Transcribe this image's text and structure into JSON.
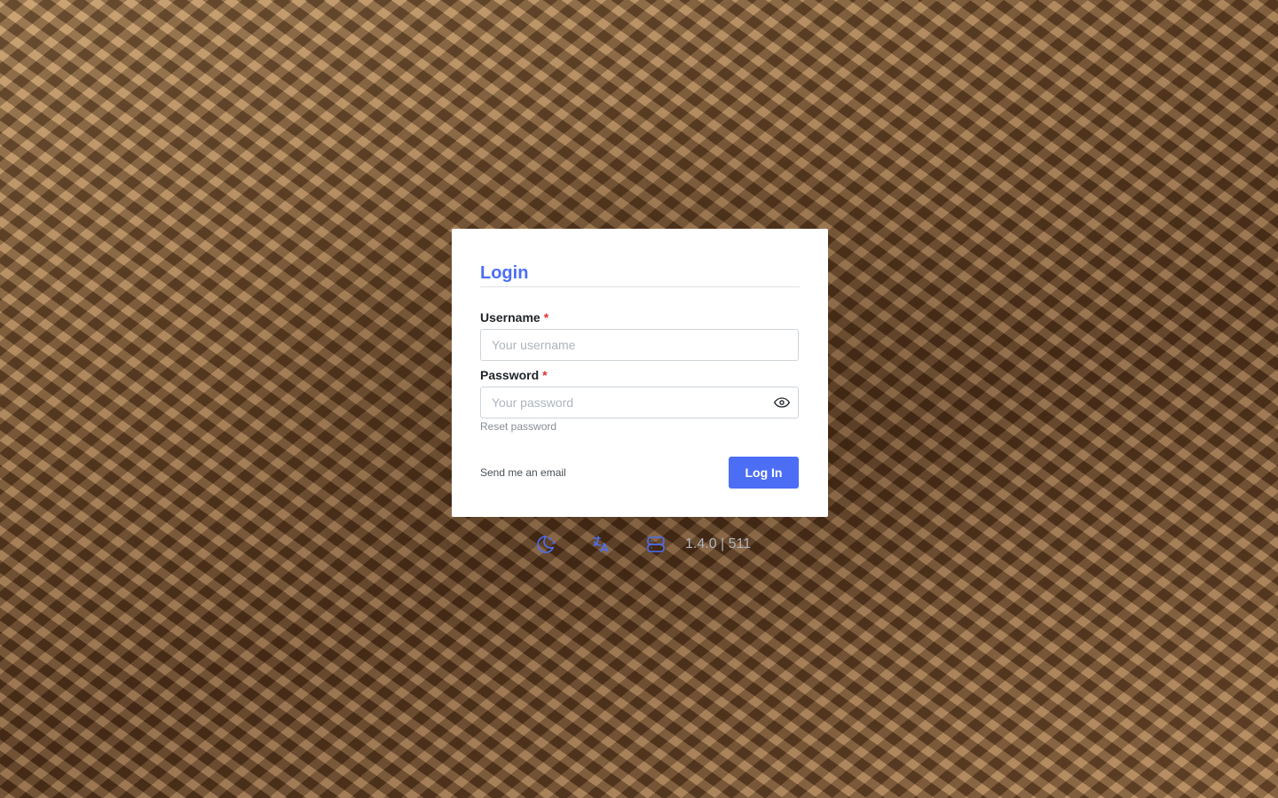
{
  "login": {
    "title": "Login",
    "username_label": "Username",
    "username_required": "*",
    "username_placeholder": "Your username",
    "username_value": "",
    "password_label": "Password",
    "password_required": "*",
    "password_placeholder": "Your password",
    "password_value": "",
    "reset_password": "Reset password",
    "send_email": "Send me an email",
    "login_button": "Log In"
  },
  "footer": {
    "icons": [
      "moon-stars-icon",
      "language-icon",
      "server-icon"
    ],
    "version": "1.4.0 | 511"
  },
  "colors": {
    "accent": "#4c6ef5",
    "required": "#e03131",
    "muted": "#adb5bd"
  }
}
